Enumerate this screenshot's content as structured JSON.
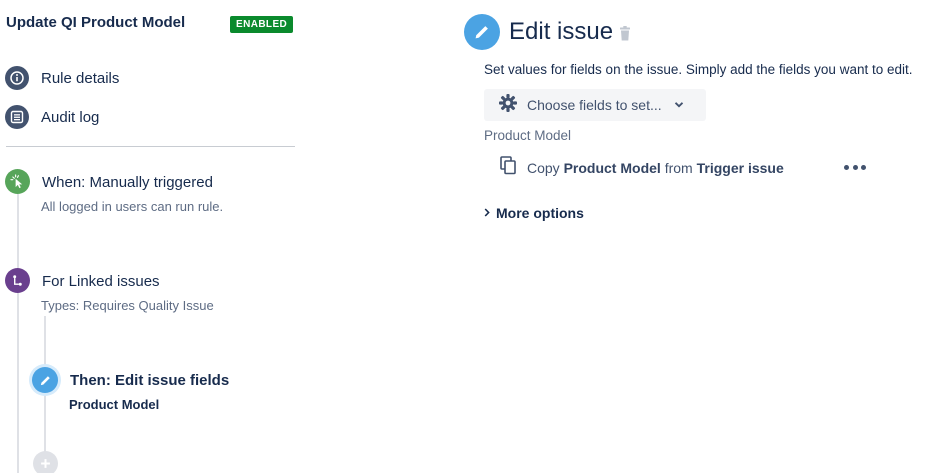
{
  "rule": {
    "title": "Update QI Product Model",
    "status_badge": "ENABLED"
  },
  "nav": {
    "rule_details": "Rule details",
    "audit_log": "Audit log"
  },
  "steps": {
    "trigger": {
      "title": "When: Manually triggered",
      "subtitle": "All logged in users can run rule."
    },
    "branch": {
      "title": "For Linked issues",
      "subtitle": "Types: Requires Quality Issue"
    },
    "action": {
      "title": "Then: Edit issue fields",
      "subtitle": "Product Model"
    }
  },
  "edit_panel": {
    "title": "Edit issue",
    "description": "Set values for fields on the issue. Simply add the fields you want to edit.",
    "choose_fields_label": "Choose fields to set...",
    "field_label": "Product Model",
    "copy_row": {
      "prefix": "Copy",
      "field": "Product Model",
      "middle": "from",
      "source": "Trigger issue"
    },
    "more_options_label": "More options"
  },
  "colors": {
    "enabled_badge": "#0a8a2d",
    "trigger_icon": "#57a55a",
    "branch_icon": "#6a3f8e",
    "action_icon": "#4ba3e3",
    "add_step_icon": "#dfe1e6"
  }
}
